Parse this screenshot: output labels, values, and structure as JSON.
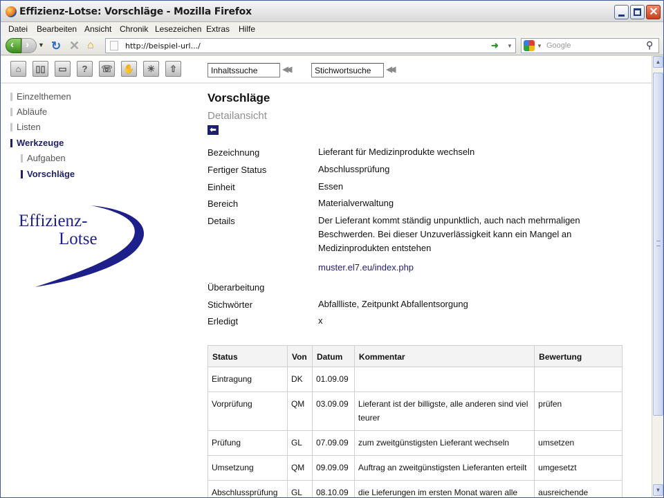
{
  "window": {
    "title": "Effizienz-Lotse: Vorschläge - Mozilla Firefox"
  },
  "menu": [
    "Datei",
    "Bearbeiten",
    "Ansicht",
    "Chronik",
    "Lesezeichen",
    "Extras",
    "Hilfe"
  ],
  "browser": {
    "url": "http://beispiel-url.../",
    "search_placeholder": "Google"
  },
  "toolbar": {
    "icons": [
      "home-icon",
      "book-icon",
      "folder-icon",
      "help-icon",
      "phone-icon",
      "hand-icon",
      "lightbulb-icon",
      "up-arrow-icon"
    ],
    "content_search": "Inhaltssuche",
    "keyword_search": "Stichwortsuche"
  },
  "sidebar": {
    "items": [
      "Einzelthemen",
      "Abläufe",
      "Listen",
      "Werkzeuge",
      "Aufgaben",
      "Vorschläge"
    ]
  },
  "logo": {
    "line1": "Effizienz-",
    "line2": "Lotse"
  },
  "page": {
    "title": "Vorschläge",
    "subtitle": "Detailansicht"
  },
  "details": {
    "bezeichnung_label": "Bezeichnung",
    "bezeichnung": "Lieferant für Medizinprodukte wechseln",
    "status_label": "Fertiger Status",
    "status": "Abschlussprüfung",
    "einheit_label": "Einheit",
    "einheit": "Essen",
    "bereich_label": "Bereich",
    "bereich": "Materialverwaltung",
    "details_label": "Details",
    "details": "Der Lieferant kommt ständig unpunktlich, auch nach mehrmaligen Beschwerden. Bei dieser Unzuverlässigkeit kann ein Mangel an Medizinprodukten entstehen",
    "link": "muster.el7.eu/index.php",
    "ueberarbeitung_label": "Überarbeitung",
    "stichwoerter_label": "Stichwörter",
    "stichwoerter": "Abfallliste, Zeitpunkt Abfallentsorgung",
    "erledigt_label": "Erledigt",
    "erledigt": "x"
  },
  "table": {
    "headers": [
      "Status",
      "Von",
      "Datum",
      "Kommentar",
      "Bewertung"
    ],
    "rows": [
      [
        "Eintragung",
        "DK",
        "01.09.09",
        "",
        ""
      ],
      [
        "Vorprüfung",
        "QM",
        "03.09.09",
        "Lieferant ist der billigste, alle anderen sind viel teurer",
        "prüfen"
      ],
      [
        "Prüfung",
        "GL",
        "07.09.09",
        "zum zweitgünstigsten Lieferant wechseln",
        "umsetzen"
      ],
      [
        "Umsetzung",
        "QM",
        "09.09.09",
        "Auftrag an zweitgünstigsten Lieferanten erteilt",
        "umgesetzt"
      ],
      [
        "Abschlussprüfung",
        "GL",
        "08.10.09",
        "die Lieferungen im ersten Monat waren alle",
        "ausreichende"
      ]
    ]
  }
}
